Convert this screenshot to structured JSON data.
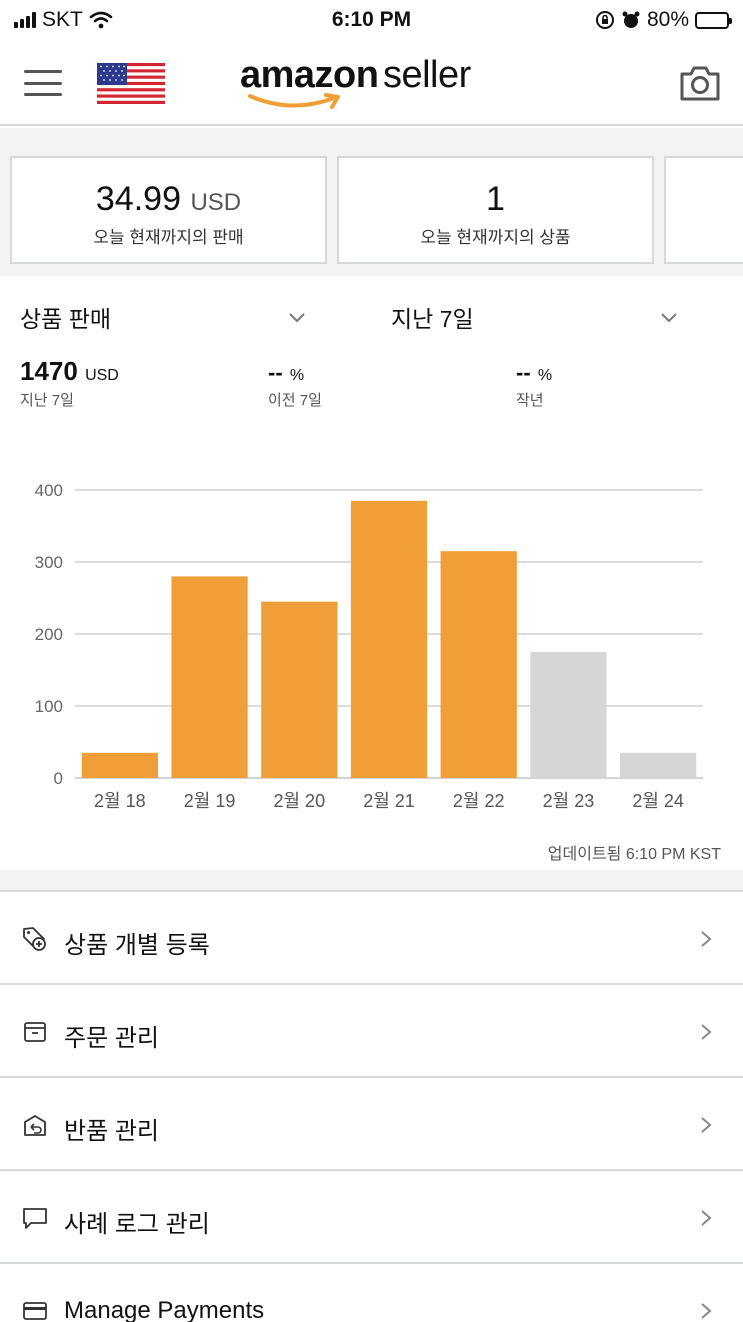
{
  "status_bar": {
    "carrier": "SKT",
    "time": "6:10 PM",
    "battery": "80%",
    "battery_level": 0.8
  },
  "header": {
    "logo_brand": "amazon",
    "logo_suffix": "seller",
    "brand_color": "#f09e38"
  },
  "metrics": [
    {
      "value": "34.99",
      "unit": "USD",
      "label": "오늘 현재까지의 판매"
    },
    {
      "value": "1",
      "unit": "",
      "label": "오늘 현재까지의 상품"
    }
  ],
  "selectors": {
    "metric": "상품 판매",
    "period": "지난 7일"
  },
  "stats": [
    {
      "value": "1470",
      "unit": "USD",
      "label": "지난 7일"
    },
    {
      "value": "--",
      "unit": "%",
      "label": "이전 7일"
    },
    {
      "value": "--",
      "unit": "%",
      "label": "작년"
    }
  ],
  "chart_data": {
    "type": "bar",
    "categories": [
      "2월 18",
      "2월 19",
      "2월 20",
      "2월 21",
      "2월 22",
      "2월 23",
      "2월 24"
    ],
    "values": [
      35,
      280,
      245,
      385,
      315,
      175,
      35
    ],
    "highlighted": [
      true,
      true,
      true,
      true,
      true,
      false,
      false
    ],
    "y_ticks": [
      "0",
      "100",
      "200",
      "300",
      "400"
    ],
    "ylim": [
      0,
      400
    ],
    "colors": {
      "active": "#f09e38",
      "inactive": "#d5d6d8"
    },
    "grid": true
  },
  "updated_text": "업데이트됨 6:10 PM KST",
  "menu": [
    {
      "icon": "tag-plus-icon",
      "label": "상품 개별 등록"
    },
    {
      "icon": "box-icon",
      "label": "주문 관리"
    },
    {
      "icon": "return-box-icon",
      "label": "반품 관리"
    },
    {
      "icon": "chat-icon",
      "label": "사례 로그 관리"
    },
    {
      "icon": "card-icon",
      "label": "Manage Payments"
    }
  ]
}
